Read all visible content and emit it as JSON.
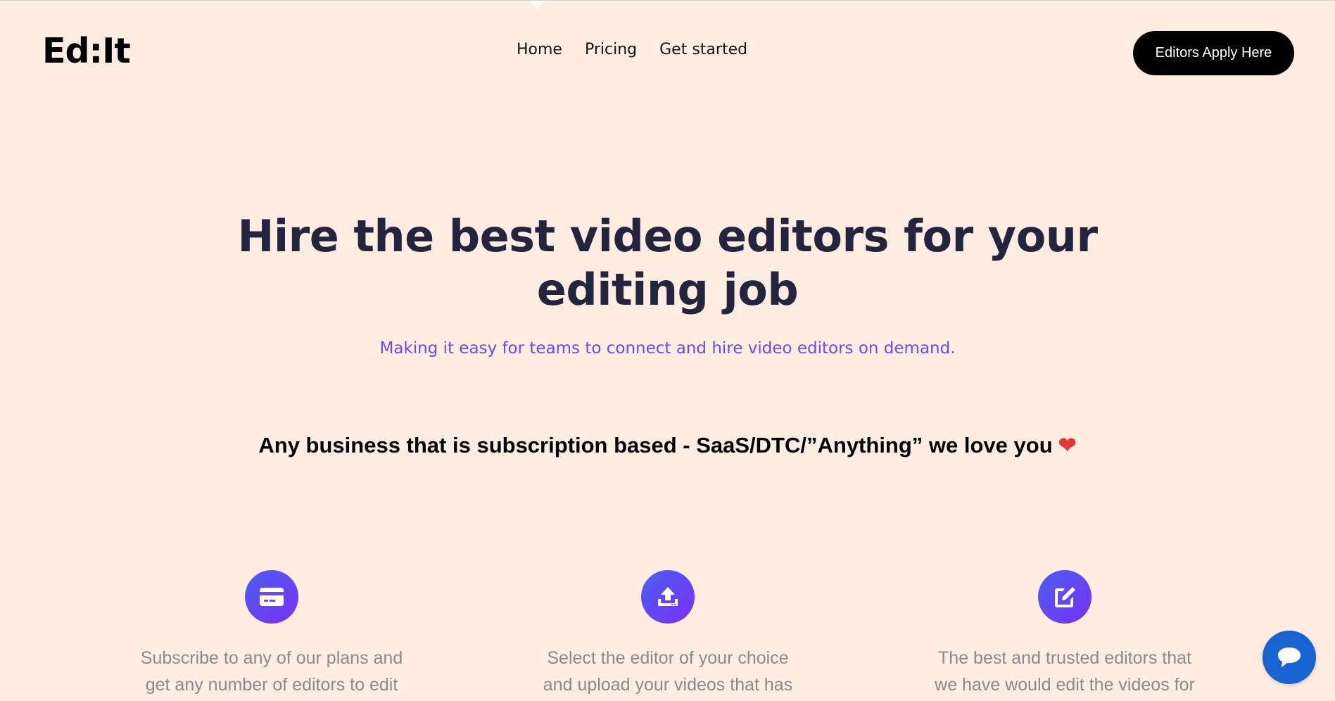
{
  "header": {
    "logo": "Ed:It",
    "nav": [
      "Home",
      "Pricing",
      "Get started"
    ],
    "cta_label": "Editors Apply Here"
  },
  "hero": {
    "headline_line1": "Hire the best video editors for your",
    "headline_line2": "editing job",
    "subtitle": "Making it easy for teams to connect and hire video editors on demand.",
    "tagline": "Any business that is subscription based - SaaS/DTC/”Anything” we love you",
    "tagline_emoji": "❤"
  },
  "features": [
    {
      "icon": "credit-card-icon",
      "line1": "Subscribe to any of our plans and",
      "line2": "get any number of editors to edit"
    },
    {
      "icon": "upload-icon",
      "line1": "Select the editor of your choice",
      "line2": "and upload your videos that has"
    },
    {
      "icon": "edit-icon",
      "line1": "The best and trusted editors that",
      "line2": "we have would edit the videos for"
    }
  ],
  "chat": {
    "icon": "chat-icon"
  },
  "colors": {
    "background": "#ffede2",
    "headline": "#23253f",
    "subtitle": "#6a4ae8",
    "cta_bg": "#000000",
    "chat_bg": "#1763d0",
    "icon_gradient_start": "#4a5ff0",
    "icon_gradient_end": "#7b2ff7"
  }
}
